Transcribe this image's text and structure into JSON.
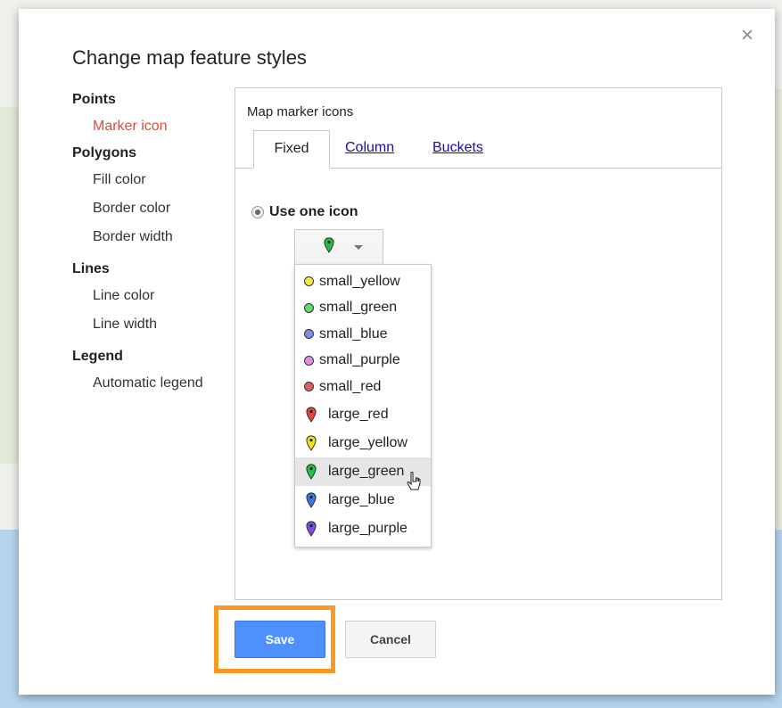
{
  "dialog": {
    "title": "Change map feature styles",
    "close_symbol": "×"
  },
  "nav": {
    "points": {
      "label": "Points",
      "items": [
        {
          "label": "Marker icon"
        }
      ]
    },
    "polygons": {
      "label": "Polygons",
      "items": [
        {
          "label": "Fill color"
        },
        {
          "label": "Border color"
        },
        {
          "label": "Border width"
        }
      ]
    },
    "lines": {
      "label": "Lines",
      "items": [
        {
          "label": "Line color"
        },
        {
          "label": "Line width"
        }
      ]
    },
    "legend": {
      "label": "Legend",
      "items": [
        {
          "label": "Automatic legend"
        }
      ]
    },
    "active_color": "#dd4b39"
  },
  "panel": {
    "heading": "Map marker icons",
    "tabs": [
      {
        "label": "Fixed"
      },
      {
        "label": "Column"
      },
      {
        "label": "Buckets"
      }
    ],
    "radio_label": "Use one icon",
    "selected_icon": "large_green",
    "icons": [
      {
        "label": "small_yellow",
        "kind": "small",
        "color": "#f4e842"
      },
      {
        "label": "small_green",
        "kind": "small",
        "color": "#5fdd6a"
      },
      {
        "label": "small_blue",
        "kind": "small",
        "color": "#7e8de0"
      },
      {
        "label": "small_purple",
        "kind": "small",
        "color": "#df8ee6"
      },
      {
        "label": "small_red",
        "kind": "small",
        "color": "#e06060"
      },
      {
        "label": "large_red",
        "kind": "large",
        "color": "#e8453c"
      },
      {
        "label": "large_yellow",
        "kind": "large",
        "color": "#f5e21b"
      },
      {
        "label": "large_green",
        "kind": "large",
        "color": "#1fc244"
      },
      {
        "label": "large_blue",
        "kind": "large",
        "color": "#3b78e7"
      },
      {
        "label": "large_purple",
        "kind": "large",
        "color": "#7a4ee6"
      }
    ]
  },
  "buttons": {
    "save": "Save",
    "cancel": "Cancel",
    "save_color": "#4d90fe",
    "highlight_color": "#f59b23"
  }
}
